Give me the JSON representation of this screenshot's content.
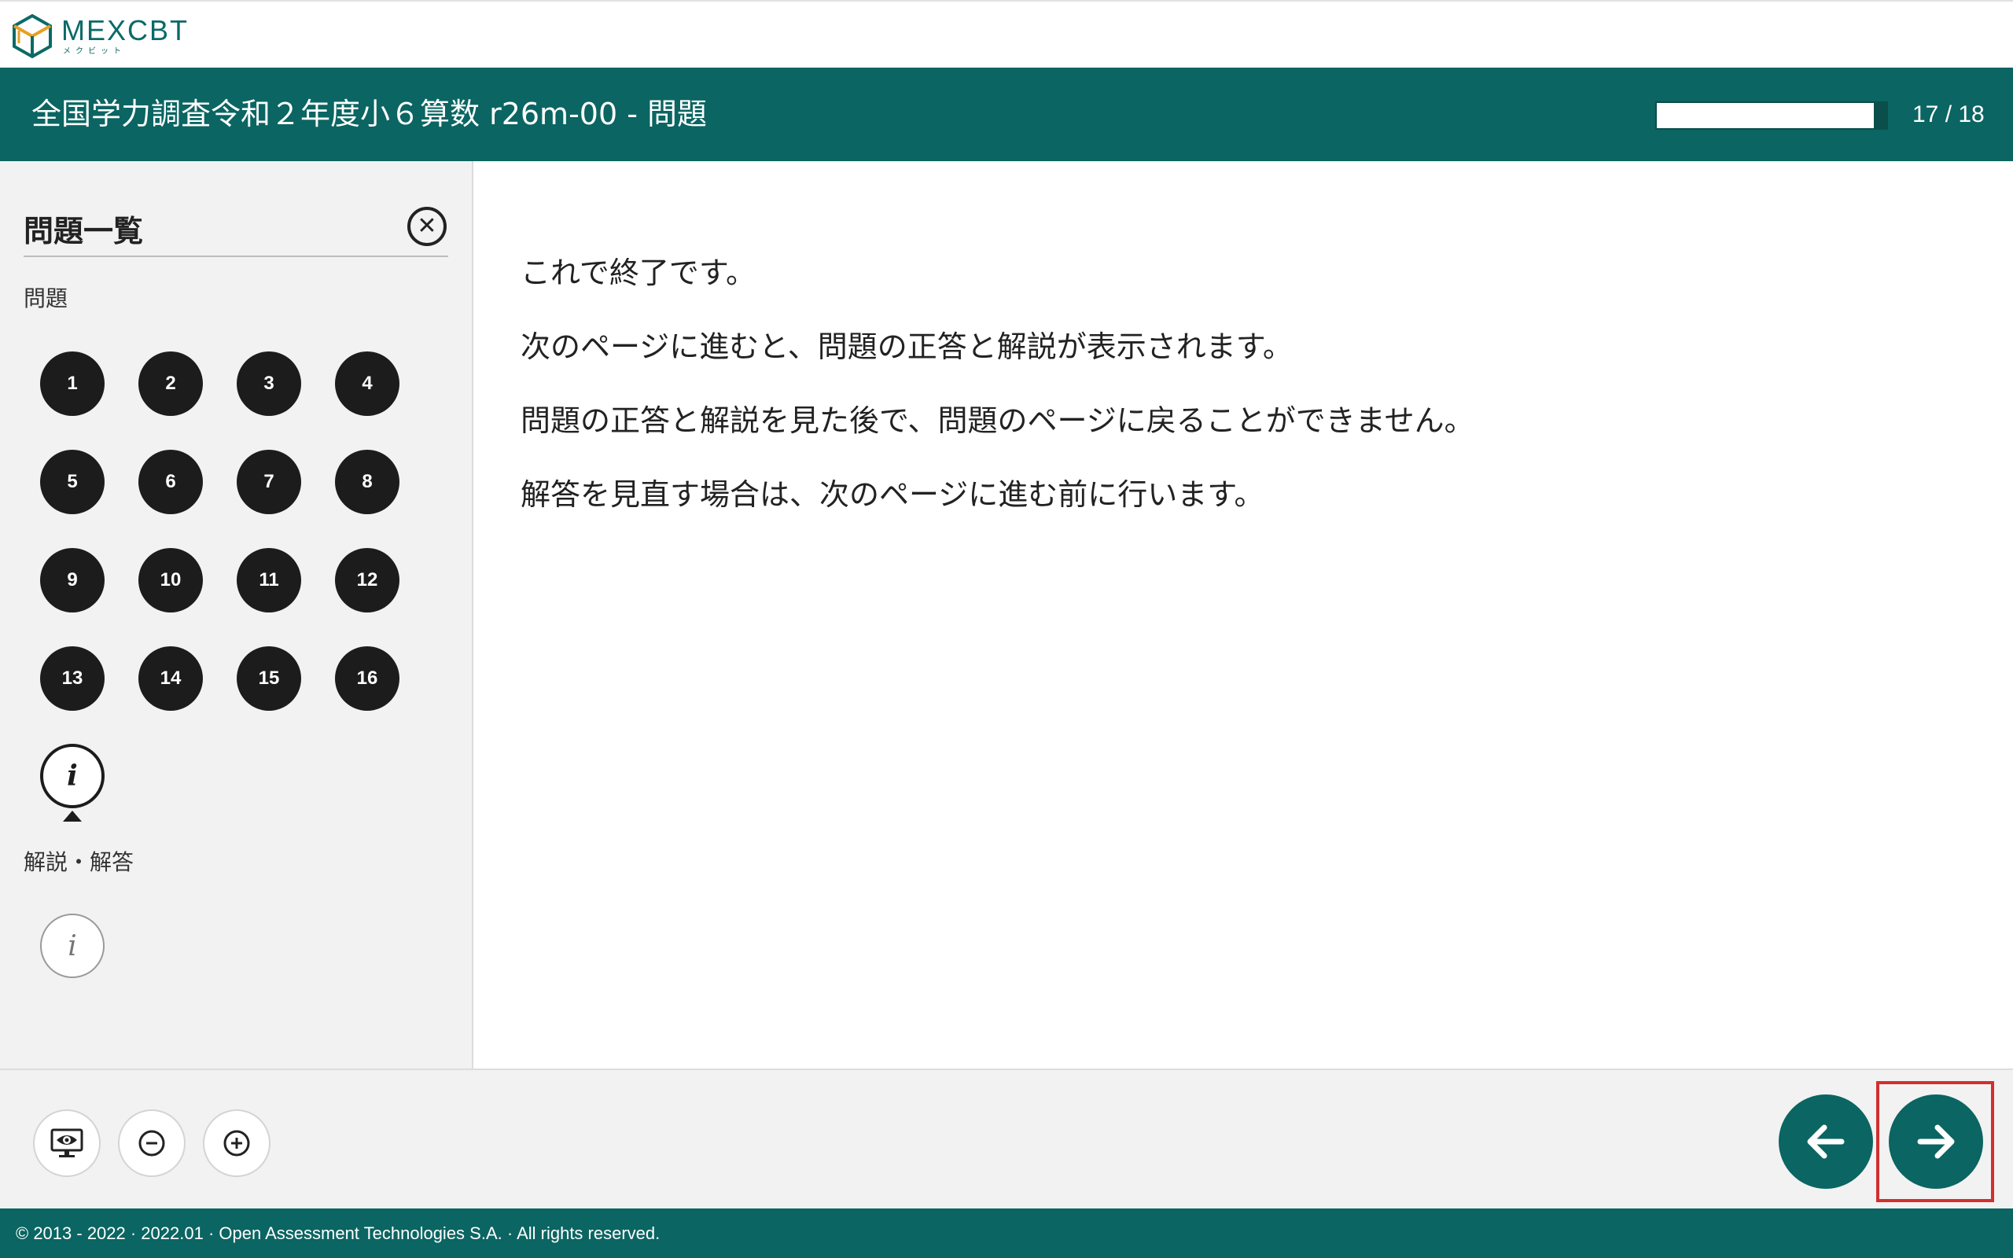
{
  "logo": {
    "main": "MEXCBT",
    "sub": "メクビット"
  },
  "header": {
    "title": "全国学力調査令和２年度小６算数 r26m-00 - 問題",
    "progress_fraction": 0.944,
    "page_counter": "17 / 18"
  },
  "sidebar": {
    "title": "問題一覧",
    "close_icon": "close-circle-icon",
    "section_questions": "問題",
    "questions": [
      "1",
      "2",
      "3",
      "4",
      "5",
      "6",
      "7",
      "8",
      "9",
      "10",
      "11",
      "12",
      "13",
      "14",
      "15",
      "16"
    ],
    "info_glyph": "i",
    "section_answers": "解説・解答"
  },
  "main": {
    "lines": [
      "これで終了です。",
      "次のページに進むと、問題の正答と解説が表示されます。",
      "問題の正答と解説を見た後で、問題のページに戻ることができません。",
      "解答を見直す場合は、次のページに進む前に行います。"
    ]
  },
  "toolbar": {
    "tools": [
      "screen-eye-icon",
      "zoom-out-icon",
      "zoom-in-icon"
    ],
    "nav": [
      "arrow-left-icon",
      "arrow-right-icon"
    ]
  },
  "footer": {
    "text": "© 2013 - 2022 · 2022.01 · Open Assessment Technologies S.A. · All rights reserved."
  },
  "colors": {
    "brand": "#0b6562",
    "highlight": "#d32f2f",
    "question_bg": "#1c1c1c"
  }
}
